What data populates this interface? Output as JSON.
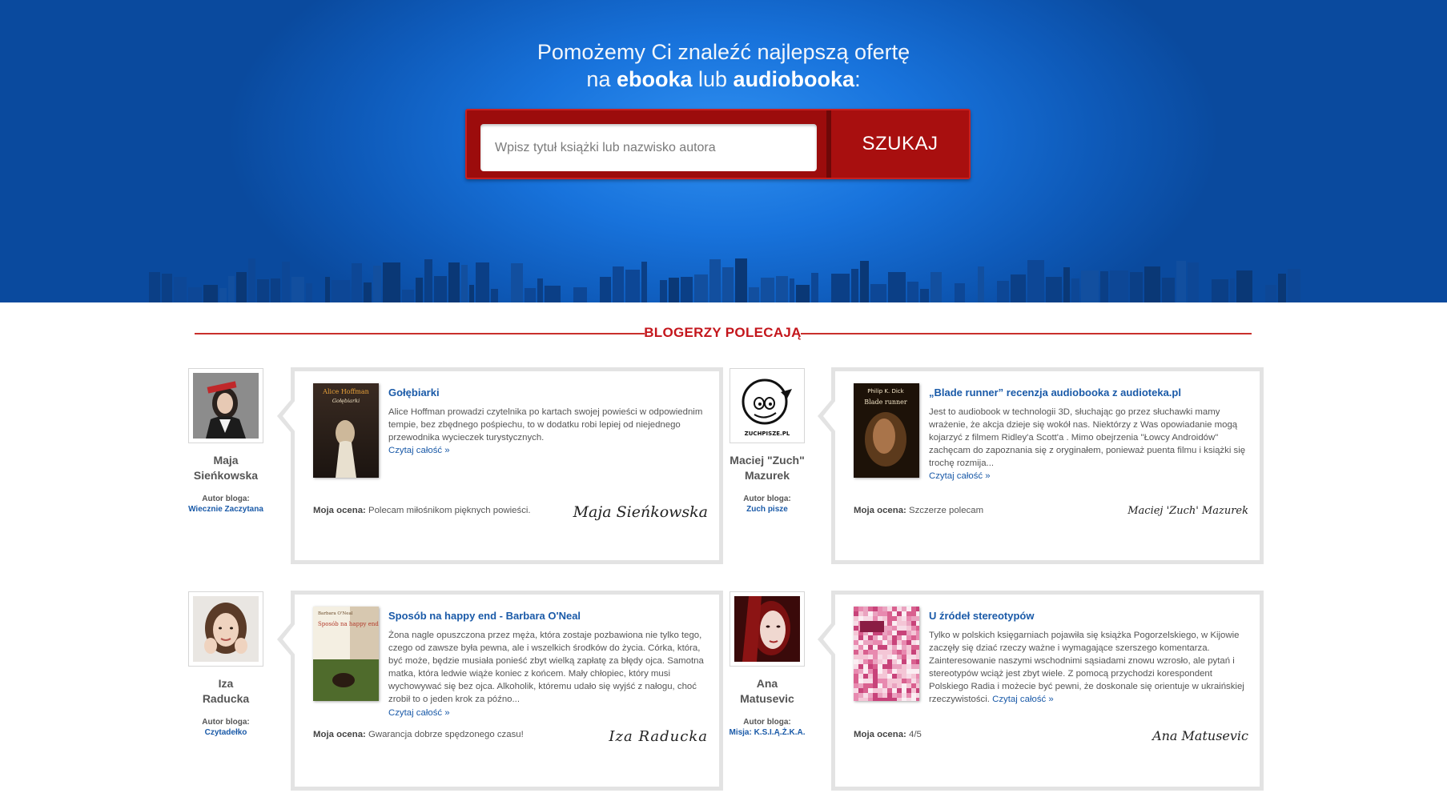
{
  "hero": {
    "line1": "Pomożemy Ci znaleźć najlepszą ofertę",
    "line2_prefix": "na ",
    "line2_ebook": "ebooka",
    "line2_mid": " lub ",
    "line2_audio": "audiobooka",
    "line2_suffix": ":"
  },
  "search": {
    "placeholder": "Wpisz tytuł książki lub nazwisko autora",
    "button_label": "SZUKAJ"
  },
  "section": {
    "title": "BLOGERZY POLECAJĄ"
  },
  "recommendations": [
    {
      "blogger": {
        "first_name": "Maja",
        "last_name": "Sieńkowska",
        "blog_label": "Autor bloga:",
        "blog_name": "Wiecznie Zaczytana"
      },
      "book": {
        "title": "Gołębiarki",
        "cover_author": "Alice Hoffman",
        "cover_title": "Gołębiarki",
        "text": "Alice Hoffman prowadzi czytelnika po kartach swojej powieści w odpowiednim tempie, bez zbędnego pośpiechu, to w dodatku robi lepiej od niejednego przewodnika wycieczek turystycznych.",
        "read_more": "Czytaj całość »",
        "rating_label": "Moja ocena:",
        "rating": "Polecam miłośnikom pięknych powieści.",
        "signature": "Maja Sieńkowska"
      }
    },
    {
      "blogger": {
        "first_name": "Maciej \"Zuch\"",
        "last_name": "Mazurek",
        "blog_label": "Autor bloga:",
        "blog_name": "Zuch pisze",
        "logo_text": "ZUCHPISZE.PL"
      },
      "book": {
        "title": "„Blade runner” recenzja audiobooka z audioteka.pl",
        "cover_author": "Philip K. Dick",
        "cover_title": "Blade runner",
        "text": "Jest to audiobook w technologii 3D, słuchając go przez słuchawki mamy wrażenie, że akcja dzieje się wokół nas. Niektórzy z Was opowiadanie mogą kojarzyć z filmem Ridley'a Scott'a . Mimo obejrzenia \"Łowcy Androidów\" zachęcam do zapoznania się z oryginałem, ponieważ puenta filmu i książki się trochę rozmija...",
        "read_more": "Czytaj całość »",
        "rating_label": "Moja ocena:",
        "rating": "Szczerze polecam",
        "signature": "Maciej 'Zuch' Mazurek"
      }
    },
    {
      "blogger": {
        "first_name": "Iza",
        "last_name": "Raducka",
        "blog_label": "Autor bloga:",
        "blog_name": "Czytadełko"
      },
      "book": {
        "title": "Sposób na happy end - Barbara O'Neal",
        "cover_author": "Barbara O'Neal",
        "cover_title": "Sposób na happy end",
        "text": "Żona nagle opuszczona przez męża, która zostaje pozbawiona nie tylko tego, czego od zawsze była pewna, ale i wszelkich środków do życia. Córka, która, być może, będzie musiała ponieść zbyt wielką zapłatę za błędy ojca. Samotna matka, która ledwie wiąże koniec z końcem. Mały chłopiec, który musi wychowywać się bez ojca. Alkoholik, któremu udało się wyjść z nałogu, choć zrobił to o jeden krok za późno...",
        "read_more": "Czytaj całość »",
        "rating_label": "Moja ocena:",
        "rating": "Gwarancja dobrze spędzonego czasu!",
        "signature": "Iza Raducka"
      }
    },
    {
      "blogger": {
        "first_name": "Ana",
        "last_name": "Matusevic",
        "blog_label": "Autor bloga:",
        "blog_name": "Misja: K.S.I.Ą.Ż.K.A."
      },
      "book": {
        "title": "U źródeł stereotypów",
        "text": "Tylko w polskich księgarniach pojawiła się książka Pogorzelskiego, w Kijowie zaczęły się dziać rzeczy ważne i wymagające szerszego komentarza. Zainteresowanie naszymi wschodnimi sąsiadami znowu wzrosło, ale pytań i stereotypów wciąż jest zbyt wiele. Z pomocą przychodzi korespondent Polskiego Radia i możecie być pewni, że doskonale się orientuje w ukraińskiej rzeczywistości.",
        "read_more": "Czytaj całość »",
        "rating_label": "Moja ocena:",
        "rating": "4/5",
        "signature": "Ana Matusevic"
      }
    }
  ],
  "colors": {
    "accent_red": "#c4161c",
    "link_blue": "#1a5aa8",
    "hero_blue": "#1873dc"
  }
}
